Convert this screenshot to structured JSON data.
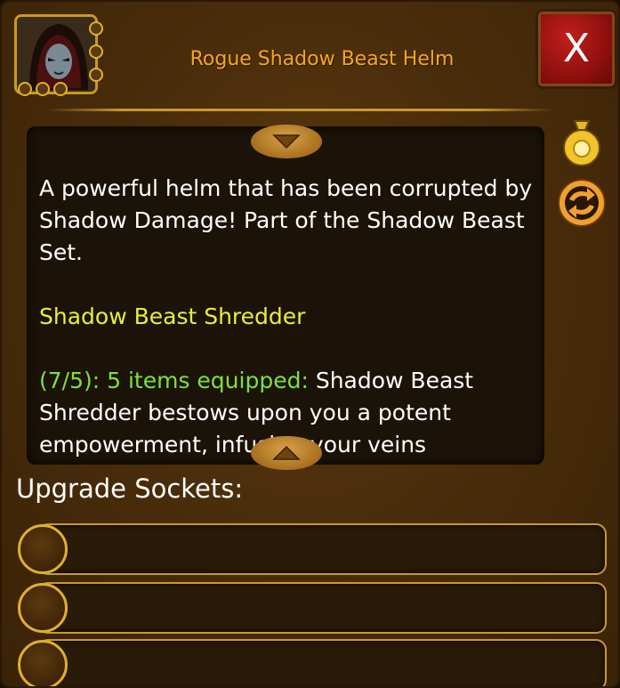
{
  "item": {
    "name": "Rogue Shadow Beast Helm",
    "icon": "hooded-rogue-portrait"
  },
  "close": {
    "label": "X"
  },
  "description": {
    "intro": "A powerful helm that has been corrupted by Shadow Damage! Part of the Shadow Beast Set.",
    "set_name": "Shadow Beast Shredder",
    "set_count": "(7/5):",
    "set_equipped": "5 items equipped:",
    "set_bonus": "Shadow Beast Shredder bestows upon you a potent empowerment, infusing your veins"
  },
  "side_icons": [
    "coin-bag-icon",
    "swap-icon"
  ],
  "sockets": {
    "label": "Upgrade Sockets:",
    "slots": [
      "",
      "",
      ""
    ]
  },
  "colors": {
    "title": "#f5a623",
    "set_name": "#e8ef3a",
    "set_count": "#7ee03a",
    "close_button": "#a8140f",
    "frame_gold": "#c99a2c"
  }
}
